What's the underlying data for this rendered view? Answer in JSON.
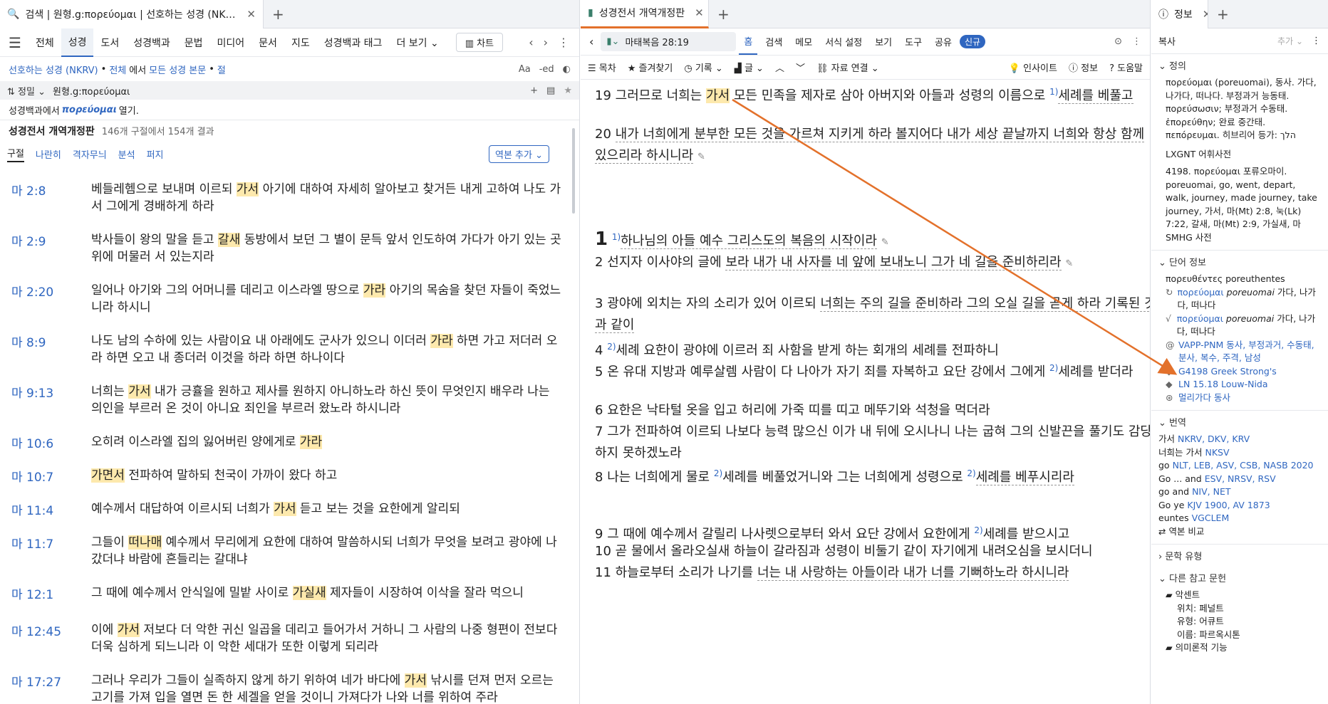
{
  "left": {
    "tab_title": "검색 | 원형.g:πορεύομαι | 선호하는 성경 (NKRV), 전체",
    "toolbar": [
      "전체",
      "성경",
      "도서",
      "성경백과",
      "문법",
      "미디어",
      "문서",
      "지도",
      "성경백과 태그",
      "더 보기"
    ],
    "chart_label": "차트",
    "scope": {
      "bible": "선호하는 성경 (NKRV)",
      "sep1": "•",
      "all": "전체",
      "in": "에서",
      "section": "모든 성경 본문",
      "sep2": "•",
      "unit": "절"
    },
    "search": {
      "option": "정밀",
      "query": "원형.g:πορεύομαι"
    },
    "open_in": {
      "pre": "성경백과에서",
      "word": "πορεύομαι",
      "post": "열기."
    },
    "results_title": "성경전서 개역개정판",
    "results_count": "146개 구절에서 154개 결과",
    "subtabs": [
      "구절",
      "나란히",
      "격자무늬",
      "분석",
      "퍼지"
    ],
    "add_version": "역본 추가",
    "rows": [
      {
        "ref": "마 2:8",
        "pre": "베들레헴으로 보내며 이르되 ",
        "hl": "가서",
        "post": " 아기에 대하여 자세히 알아보고 찾거든 내게 고하여 나도 가서 그에게 경배하게 하라"
      },
      {
        "ref": "마 2:9",
        "pre": "박사들이 왕의 말을 듣고 ",
        "hl": "갈새",
        "post": " 동방에서 보던 그 별이 문득 앞서 인도하여 가다가 아기 있는 곳 위에 머물러 서 있는지라"
      },
      {
        "ref": "마 2:20",
        "pre": "일어나 아기와 그의 어머니를 데리고 이스라엘 땅으로 ",
        "hl": "가라",
        "post": " 아기의 목숨을 찾던 자들이 죽었느니라 하시니"
      },
      {
        "ref": "마 8:9",
        "pre": "나도 남의 수하에 있는 사람이요 내 아래에도 군사가 있으니 이더러 ",
        "hl": "가라",
        "post": " 하면 가고 저더러 오라 하면 오고 내 종더러 이것을 하라 하면 하나이다"
      },
      {
        "ref": "마 9:13",
        "pre": "너희는 ",
        "hl": "가서",
        "post": " 내가 긍휼을 원하고 제사를 원하지 아니하노라 하신 뜻이 무엇인지 배우라 나는 의인을 부르러 온 것이 아니요 죄인을 부르러 왔노라 하시니라"
      },
      {
        "ref": "마 10:6",
        "pre": "오히려 이스라엘 집의 잃어버린 양에게로 ",
        "hl": "가라",
        "post": ""
      },
      {
        "ref": "마 10:7",
        "pre": "",
        "hl": "가면서",
        "post": " 전파하여 말하되 천국이 가까이 왔다 하고"
      },
      {
        "ref": "마 11:4",
        "pre": "예수께서 대답하여 이르시되 너희가 ",
        "hl": "가서",
        "post": " 듣고 보는 것을 요한에게 알리되"
      },
      {
        "ref": "마 11:7",
        "pre": "그들이 ",
        "hl": "떠나매",
        "post": " 예수께서 무리에게 요한에 대하여 말씀하시되 너희가 무엇을 보려고 광야에 나갔더냐 바람에 흔들리는 갈대냐"
      },
      {
        "ref": "마 12:1",
        "pre": "그 때에 예수께서 안식일에 밀밭 사이로 ",
        "hl": "가실새",
        "post": " 제자들이 시장하여 이삭을 잘라 먹으니"
      },
      {
        "ref": "마 12:45",
        "pre": "이에 ",
        "hl": "가서",
        "post": " 저보다 더 악한 귀신 일곱을 데리고 들어가서 거하니 그 사람의 나중 형편이 전보다 더욱 심하게 되느니라 이 악한 세대가 또한 이렇게 되리라"
      },
      {
        "ref": "마 17:27",
        "pre": "그러나 우리가 그들이 실족하지 않게 하기 위하여 네가 바다에 ",
        "hl": "가서",
        "post": " 낚시를 던져 먼저 오르는 고기를 가져 입을 열면 돈 한 세겔을 얻을 것이니 가져다가 나와 너를 위하여 주라"
      }
    ]
  },
  "mid": {
    "tab_title": "성경전서 개역개정판",
    "ref": "마태복음 28:19",
    "nav": [
      "홈",
      "검색",
      "메모",
      "서식 설정",
      "보기",
      "도구",
      "공유"
    ],
    "new_badge": "신규",
    "tools": [
      "목차",
      "즐겨찾기",
      "기록",
      "글",
      "자료 연결"
    ],
    "tools_right": [
      "인사이트",
      "정보",
      "도움말"
    ],
    "verses": [
      {
        "n": "19",
        "t1": "그러므로 너희는 ",
        "hl": "가서",
        "t2": " 모든 민족을 제자로 삼아 아버지와 아들과 성령의 이름으로 ",
        "sup": "1)",
        "t3": "세례를 베풀고"
      },
      {
        "n": "20",
        "t1": "내가 너희에게 분부한 모든 것을 가르쳐 지키게 하라 볼지어다 내가 세상 끝날까지 너희와 항상 함께 있으리라 하시니라"
      },
      {
        "n": "1",
        "t1": "하나님의 아들 예수 그리스도의 복음의 시작이라",
        "sup": "1)"
      },
      {
        "n": "2",
        "t1": "선지자 이사야의 글에 ",
        "t2": "보라 내가 내 사자를 네 앞에 보내노니 그가 네 길을 준비하리라"
      },
      {
        "n": "3",
        "t1": "광야에 외치는 자의 소리가 있어 이르되 ",
        "t2": "너희는 주의 길을 준비하라 그의 오실 길을 곧게 하라 기록된 것과 같이"
      },
      {
        "n": "4",
        "sup": "2)",
        "t1": "세례 요한이 광야에 이르러 죄 사함을 받게 하는 회개의 세례를 전파하니"
      },
      {
        "n": "5",
        "t1": "온 유대 지방과 예루살렘 사람이 다 나아가 자기 죄를 자복하고 요단 강에서 그에게 ",
        "sup": "2)",
        "t2": "세례를 받더라"
      },
      {
        "n": "6",
        "t1": "요한은 낙타털 옷을 입고 허리에 가죽 띠를 띠고 메뚜기와 석청을 먹더라"
      },
      {
        "n": "7",
        "t1": "그가 전파하여 이르되 ",
        "t2": "나보다 능력 많으신 이가 내 뒤에 오시나니 나는 굽혀 그의 신발끈을 풀기도 감당하지 못하겠노라"
      },
      {
        "n": "8",
        "t1": "나는 너희에게 물로 ",
        "sup": "2)",
        "t2": "세례를 베풀었거니와 그는 너희에게 성령으로 ",
        "sup2": "2)",
        "t3": "세례를 베푸시리라"
      },
      {
        "n": "9",
        "t1": "그 때에 예수께서 갈릴리 나사렛으로부터 와서 요단 강에서 요한에게 ",
        "sup": "2)",
        "t2": "세례를 받으시고"
      },
      {
        "n": "10",
        "t1": "곧 물에서 올라오실새 하늘이 갈라짐과 성령이 비둘기 같이 자기에게 내려오심을 보시더니"
      },
      {
        "n": "11",
        "t1": "하늘로부터 소리가 나기를 ",
        "t2": "너는 내 사랑하는 아들이라 내가 너를 기뻐하노라 하시니라"
      }
    ]
  },
  "right": {
    "tab_title": "정보",
    "copy": "복사",
    "add": "추가",
    "def_title": "정의",
    "def_lines": [
      "πορεύομαι (poreuomai), 동사. 가다, 나가다, 떠나다. 부정과거 능동태. πορεύσωσιν; 부정과거 수동태. ἐπορεύθην; 완료 중간태. πεπόρευμαι. 히브리어 등가: הלך"
    ],
    "lex_title": "LXGNT 어휘사전",
    "lex_lines": [
      "4198. πορεύομαι 포류오마이. poreuomai, go, went, depart, walk, journey, made journey, take journey, 가서, 마(Mt) 2:8, 눅(Lk) 7:22, 갈새, 마(Mt) 2:9, 가실새, 마"
    ],
    "smhg": "SMHG 사전",
    "word_title": "단어 정보",
    "word_form": "πορευθέντες poreuthentes",
    "word_items": [
      {
        "greek": "πορεύομαι",
        "translit": "poreuomai",
        "gloss": "가다, 나가다, 떠나다"
      },
      {
        "greek": "πορεύομαι",
        "translit": "poreuomai",
        "gloss": "가다, 나가다, 떠나다"
      }
    ],
    "morph": "VAPP-PNM 동사, 부정과거, 수동태, 분사, 복수, 주격, 남성",
    "strongs": "G4198 Greek Strong's",
    "ln": "LN 15.18 Louw-Nida",
    "melaka": "멀리가다 동사",
    "trans_title": "번역",
    "trans_lines": [
      {
        "w": "가서",
        "v": "NKRV, DKV, KRV"
      },
      {
        "w": "너희는 가서",
        "v": "NKSV"
      },
      {
        "w": "go",
        "v": "NLT, LEB, ASV, CSB, NASB 2020"
      },
      {
        "w": "Go ... and",
        "v": "ESV, NRSV, RSV"
      },
      {
        "w": "go and",
        "v": "NIV, NET"
      },
      {
        "w": "Go ye",
        "v": "KJV 1900, AV 1873"
      },
      {
        "w": "euntes",
        "v": "VGCLEM"
      }
    ],
    "compare": "역본 비교",
    "lit_title": "문학 유형",
    "ref_title": "다른 참고 문헌",
    "accent_title": "악센트",
    "accent_lines": [
      {
        "k": "위치:",
        "v": "페널트"
      },
      {
        "k": "유형:",
        "v": "어큐트"
      },
      {
        "k": "이름:",
        "v": "파르옥시톤"
      }
    ],
    "more": "의미론적 기능"
  },
  "colors": {
    "accent": "#2f66c0",
    "highlight": "#fde9ad",
    "arrow": "#e3712b"
  }
}
